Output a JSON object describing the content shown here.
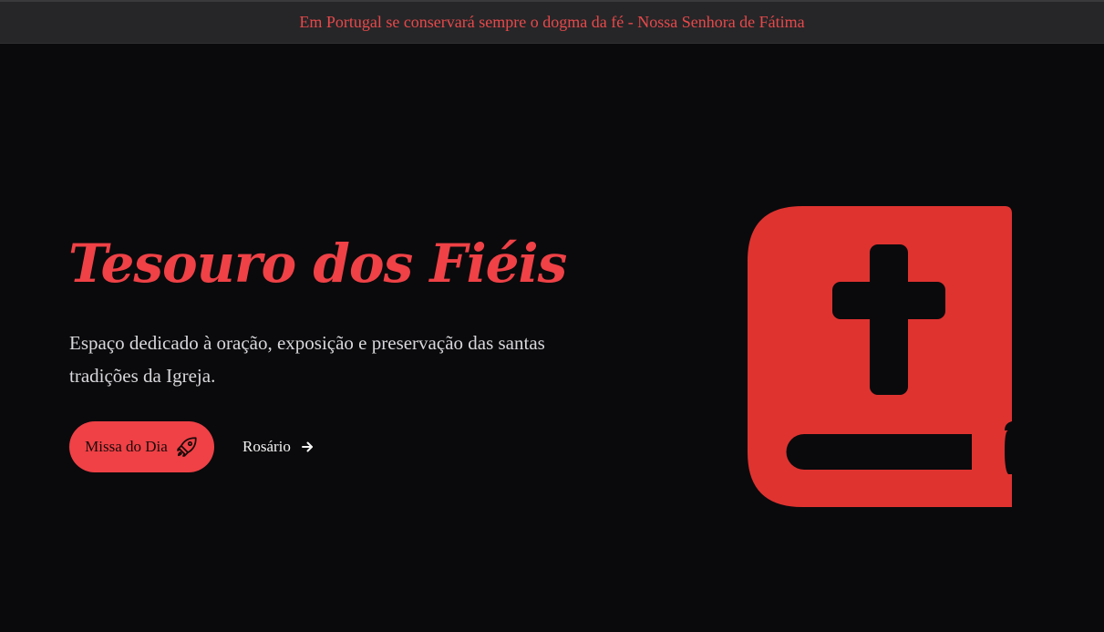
{
  "banner": {
    "text": "Em Portugal se conservará sempre o dogma da fé - Nossa Senhora de Fátima"
  },
  "hero": {
    "title": "Tesouro dos Fiéis",
    "description": "Espaço dedicado à oração, exposição e preservação das santas tradições da Igreja.",
    "primary_button": {
      "label": "Missa do Dia",
      "icon": "rocket-icon"
    },
    "secondary_link": {
      "label": "Rosário",
      "icon": "arrow-right-icon"
    },
    "illustration": {
      "icon": "bible-icon"
    }
  },
  "colors": {
    "accent": "#ef4146",
    "background": "#0a0a0c",
    "banner_background": "#262628",
    "text_light": "#d8d8dc"
  }
}
